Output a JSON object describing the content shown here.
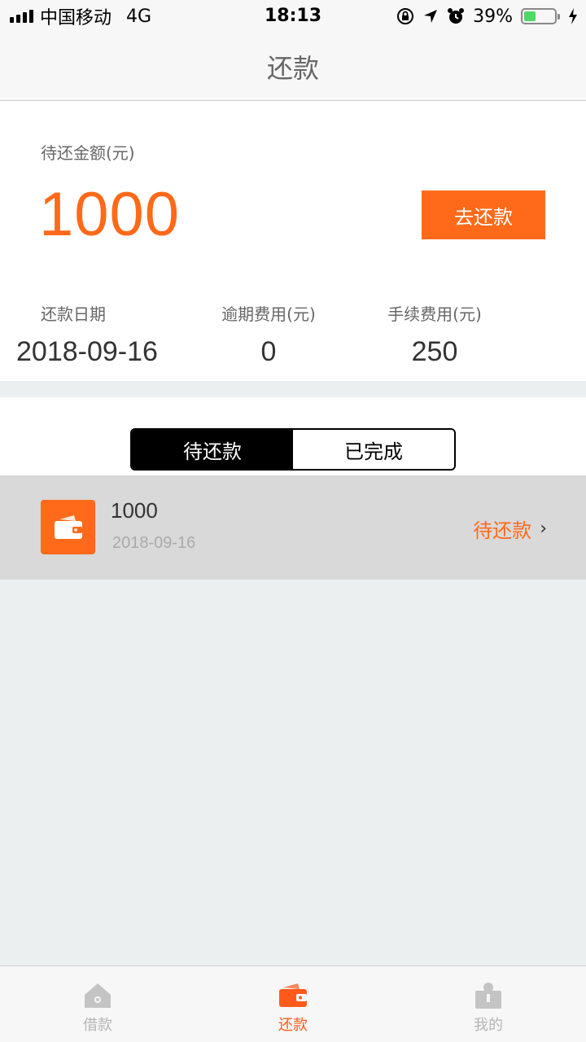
{
  "status_bar": {
    "carrier": "中国移动",
    "network": "4G",
    "time": "18:13",
    "battery_percent": "39%",
    "battery_level": 0.39
  },
  "nav": {
    "title": "还款"
  },
  "summary": {
    "amount_label": "待还金额(元)",
    "amount_value": "1000",
    "repay_button": "去还款",
    "info": [
      {
        "label": "还款日期",
        "value": "2018-09-16"
      },
      {
        "label": "逾期费用(元)",
        "value": "0"
      },
      {
        "label": "手续费用(元)",
        "value": "250"
      }
    ]
  },
  "segments": {
    "pending": "待还款",
    "completed": "已完成"
  },
  "list": [
    {
      "amount": "1000",
      "date": "2018-09-16",
      "status": "待还款"
    }
  ],
  "tabs": [
    {
      "label": "借款"
    },
    {
      "label": "还款"
    },
    {
      "label": "我的"
    }
  ],
  "colors": {
    "accent": "#ff6a1a",
    "background": "#ebeff0"
  }
}
